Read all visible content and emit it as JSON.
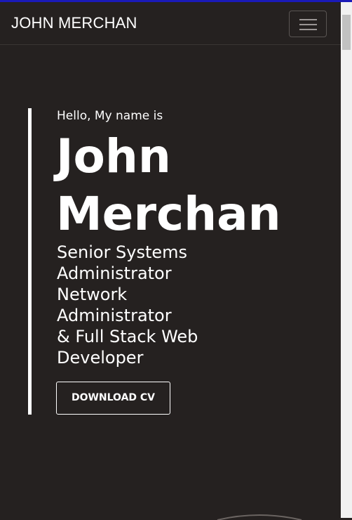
{
  "navbar": {
    "brand": "JOHN MERCHAN",
    "toggler_icon": "hamburger-icon"
  },
  "hero": {
    "greeting": "Hello, My name is",
    "name_line1": "John",
    "name_line2": "Merchan",
    "role_lines": [
      "Senior Systems",
      "Administrator",
      "Network",
      "Administrator",
      "& Full Stack Web",
      "Developer"
    ],
    "download_button": "DOWNLOAD CV"
  },
  "colors": {
    "background": "#252120",
    "text": "#ffffff",
    "accent_top": "#1a1ab8"
  }
}
